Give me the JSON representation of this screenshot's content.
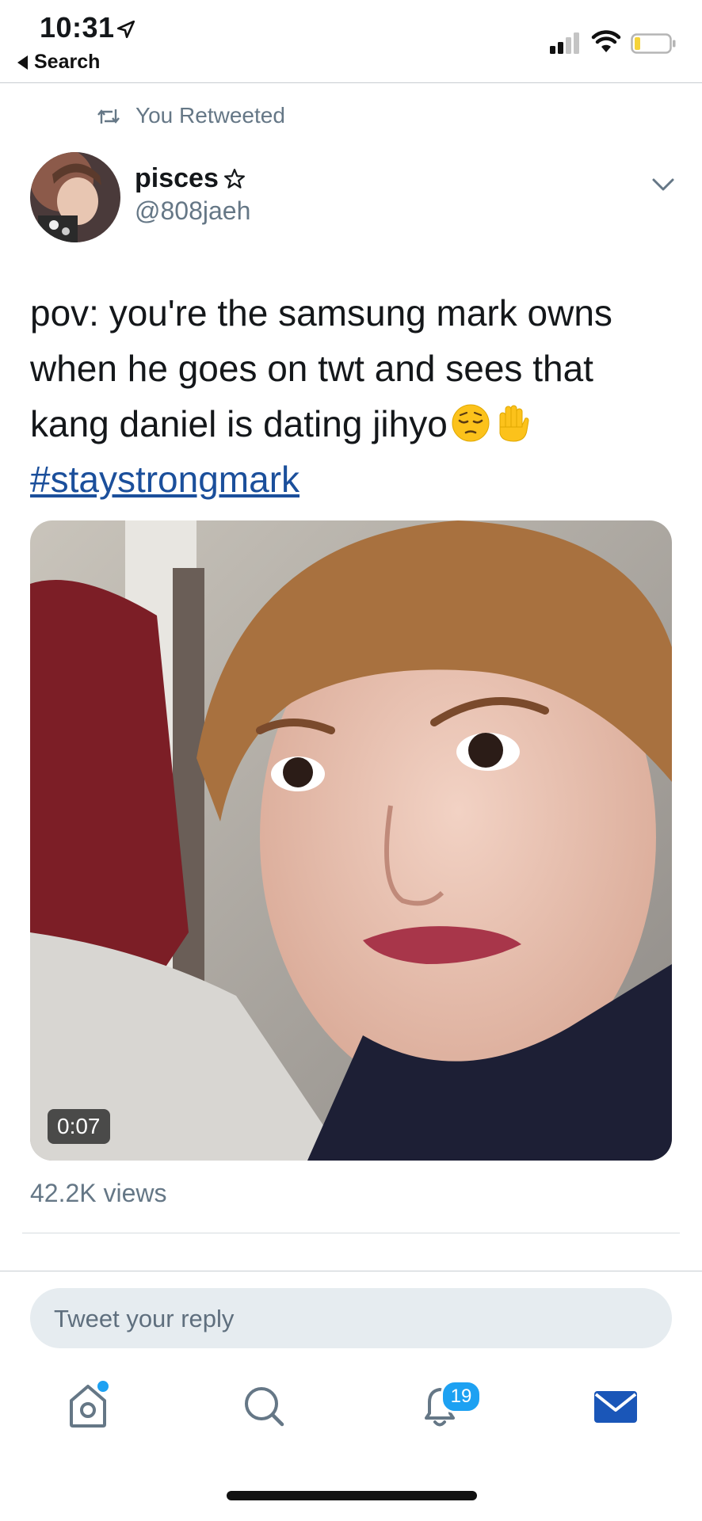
{
  "status_bar": {
    "time": "10:31",
    "back_label": "Search"
  },
  "retweet": {
    "label": "You Retweeted"
  },
  "author": {
    "display_name": "pisces",
    "handle": "@808jaeh"
  },
  "tweet": {
    "text": "pov: you're the samsung mark owns when he goes on twt and sees that kang daniel is dating jihyo",
    "emojis": [
      "pensive-face",
      "raised-hand"
    ],
    "hashtag": "#staystrongmark"
  },
  "media": {
    "type": "video",
    "duration": "0:07",
    "views": "42.2K views"
  },
  "reply": {
    "placeholder": "Tweet your reply"
  },
  "tab_bar": {
    "items": [
      "home",
      "search",
      "notifications",
      "messages"
    ],
    "notifications_badge": "19",
    "active": "messages"
  },
  "colors": {
    "accent": "#1da1f2",
    "link": "#1b4f9b",
    "secondary_text": "#657786",
    "reply_bg": "#e6ecf0"
  }
}
